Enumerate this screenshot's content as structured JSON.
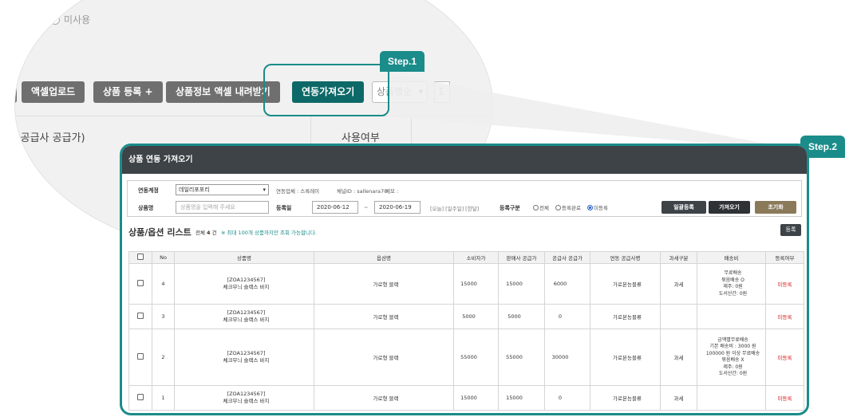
{
  "background": {
    "unused_radio_label": "미사용",
    "buttons": {
      "excel_upload": "액셀업로드",
      "product_register": "상품 등록 +",
      "product_excel_download": "상품정보 액셀 내려받기",
      "linked_import": "연동가져오기"
    },
    "sort_select": "상품명순",
    "extra_field": "1",
    "columns": {
      "price_col": "사 / 공급사 공급가)",
      "use_col": "사용여부"
    }
  },
  "steps": {
    "step1": "Step.1",
    "step2": "Step.2"
  },
  "modal": {
    "title": "상품 연동 가져오기",
    "filters": {
      "account_label": "연동계정",
      "account_value": "데일리포포리",
      "partner_text": "연동업체 : 스록레이",
      "channel_text": "채널ID : sallenara70",
      "memo_text": "메모 :",
      "product_name_label": "상품명",
      "product_name_placeholder": "상품명을 입력해 주세요",
      "date_label": "등록일",
      "date_from": "2020-06-12",
      "date_sep": "~",
      "date_to": "2020-06-19",
      "quick_dates": "[오늘] [일주일] [한달]",
      "status_label": "등록구분",
      "status_options": [
        "전체",
        "등록완료",
        "미등록"
      ],
      "status_selected": "미등록",
      "bulk_register_button": "일괄등록",
      "import_button": "가져오기",
      "reset_button": "초기화"
    },
    "list": {
      "title": "상품/옵션 리스트",
      "count_prefix": "전체",
      "count_value": "4",
      "count_suffix": "건",
      "note": "※ 최대 100개 상품까지만 조회 가능합니다.",
      "register_button": "등록"
    },
    "table": {
      "headers": [
        "",
        "No",
        "상품명",
        "옵션명",
        "소비자가",
        "판매사 공급가",
        "공급사 공급가",
        "연동 공급사명",
        "과세구분",
        "배송비",
        "등록여부"
      ],
      "rows": [
        {
          "no": "4",
          "code": "[ZOA1234567]",
          "name": "체크무늬 슬랙스 바지",
          "option": "가로형 블랙",
          "consumer_price": "15000",
          "seller_supply": "15000",
          "supplier_supply": "6000",
          "supplier_name": "가로본능블류",
          "tax": "과세",
          "shipping": [
            "무료배송",
            "묶음배송 O",
            "제주: 0원",
            "도서산간: 0원"
          ],
          "status": "미등록"
        },
        {
          "no": "3",
          "code": "[ZOA1234567]",
          "name": "체크무늬 슬랙스 바지",
          "option": "가로형 블랙",
          "consumer_price": "5000",
          "seller_supply": "5000",
          "supplier_supply": "0",
          "supplier_name": "가로본능블류",
          "tax": "과세",
          "shipping": [],
          "status": "미등록"
        },
        {
          "no": "2",
          "code": "[ZOA1234567]",
          "name": "체크무늬 슬랙스 바지",
          "option": "가로형 블랙",
          "consumer_price": "55000",
          "seller_supply": "55000",
          "supplier_supply": "30000",
          "supplier_name": "가로본능블류",
          "tax": "과세",
          "shipping": [
            "금액별무료배송",
            "기본 배송비 : 3000 원",
            "100000 원 이상 무료배송",
            "묶음배송 X",
            "제주: 0원",
            "도서산간: 0원"
          ],
          "status": "미등록"
        },
        {
          "no": "1",
          "code": "[ZOA1234567]",
          "name": "체크무늬 슬랙스 바지",
          "option": "가로형 블랙",
          "consumer_price": "15000",
          "seller_supply": "15000",
          "supplier_supply": "0",
          "supplier_name": "가로본능블류",
          "tax": "과세",
          "shipping": [],
          "status": "미등록"
        }
      ]
    }
  },
  "colors": {
    "accent_teal": "#1a8c8a",
    "dark_header": "#3d4347",
    "status_red": "#d61f1f",
    "import_button_bg": "#0d6968"
  }
}
